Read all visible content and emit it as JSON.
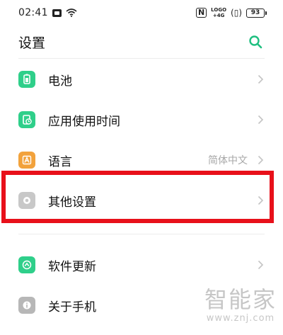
{
  "status_bar": {
    "time": "02:41",
    "lte_top": "LOGO",
    "lte_bottom": "+4G",
    "battery": "93"
  },
  "header": {
    "title": "设置",
    "search_icon": "search-icon"
  },
  "items": [
    {
      "label": "电池",
      "value": "",
      "icon": "battery-icon",
      "color": "#2fcf8a"
    },
    {
      "label": "应用使用时间",
      "value": "",
      "icon": "app-usage-icon",
      "color": "#2fcf8a"
    },
    {
      "label": "语言",
      "value": "简体中文",
      "icon": "language-icon",
      "color": "#f2a23c"
    },
    {
      "label": "其他设置",
      "value": "",
      "icon": "other-settings-icon",
      "color": "#c8c8c8"
    },
    {
      "label": "软件更新",
      "value": "",
      "icon": "software-update-icon",
      "color": "#2fcf8a"
    },
    {
      "label": "关于手机",
      "value": "",
      "icon": "about-phone-icon",
      "color": "#b7b7b7"
    }
  ],
  "watermark": {
    "main": "智能家",
    "sub": "www.znj.com"
  },
  "colors": {
    "accent": "#1fbf80",
    "highlight": "#e8101a"
  }
}
